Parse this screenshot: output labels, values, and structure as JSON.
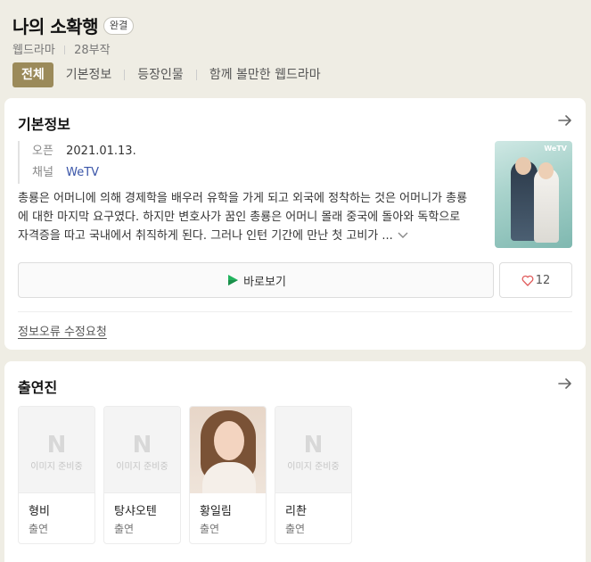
{
  "header": {
    "title": "나의 소확행",
    "status_badge": "완결",
    "category": "웹드라마",
    "episodes": "28부작"
  },
  "tabs": [
    {
      "label": "전체",
      "active": true
    },
    {
      "label": "기본정보",
      "active": false
    },
    {
      "label": "등장인물",
      "active": false
    },
    {
      "label": "함께 볼만한 웹드라마",
      "active": false
    }
  ],
  "basic_info": {
    "section_title": "기본정보",
    "open_label": "오픈",
    "open_date": "2021.01.13.",
    "channel_label": "채널",
    "channel_value": "WeTV",
    "poster_logo": "WeTV",
    "description": "총룡은 어머니에 의해 경제학을 배우러 유학을 가게 되고 외국에 정착하는 것은 어머니가 총룡에 대한 마지막 요구였다. 하지만 변호사가 꿈인 총룡은 어머니 몰래 중국에 돌아와 독학으로 자격증을 따고 국내에서 취직하게 된다. 그러나 인턴 기간에 만난 첫 고비가 ...",
    "watch_label": "바로보기",
    "like_count": "12",
    "report_link": "정보오류 수정요청"
  },
  "cast": {
    "section_title": "출연진",
    "placeholder_letter": "N",
    "placeholder_text": "이미지 준비중",
    "members": [
      {
        "name": "형비",
        "role": "출연",
        "has_photo": false
      },
      {
        "name": "탕샤오텐",
        "role": "출연",
        "has_photo": false
      },
      {
        "name": "황일림",
        "role": "출연",
        "has_photo": true
      },
      {
        "name": "리촨",
        "role": "출연",
        "has_photo": false
      }
    ]
  },
  "colors": {
    "background": "#efede4",
    "tab_active": "#9b8a5a",
    "channel_link": "#3a55a8",
    "heart": "#e05a5a"
  },
  "icons": {
    "arrow": "arrow-right-icon",
    "expand": "chevron-down-icon",
    "play": "play-icon",
    "heart": "heart-icon"
  }
}
